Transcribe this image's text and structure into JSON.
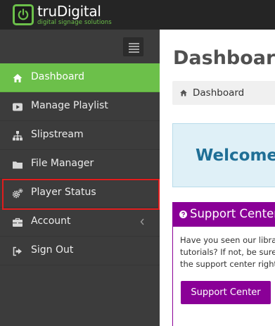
{
  "brand": {
    "name": "truDigital",
    "tagline": "digital signage solutions",
    "accent": "#6cc04a"
  },
  "sidebar": {
    "items": [
      {
        "label": "Dashboard",
        "icon": "home-icon",
        "active": true
      },
      {
        "label": "Manage Playlist",
        "icon": "play-icon",
        "active": false
      },
      {
        "label": "Slipstream",
        "icon": "sitemap-icon",
        "active": false
      },
      {
        "label": "File Manager",
        "icon": "folder-icon",
        "active": false
      },
      {
        "label": "Player Status",
        "icon": "gears-icon",
        "active": false
      },
      {
        "label": "Account",
        "icon": "briefcase-icon",
        "active": false
      },
      {
        "label": "Sign Out",
        "icon": "sign-out-icon",
        "active": false
      }
    ],
    "highlight_color": "#e11d1d"
  },
  "main": {
    "title": "Dashboard",
    "breadcrumb": "Dashboard",
    "welcome": "Welcome",
    "support": {
      "title": "Support Center",
      "body_lines": [
        "Have you seen our library of",
        "tutorials? If not, be sure to visit",
        "the support center right now."
      ],
      "button_label": "Support Center",
      "color": "#8a0097"
    }
  }
}
